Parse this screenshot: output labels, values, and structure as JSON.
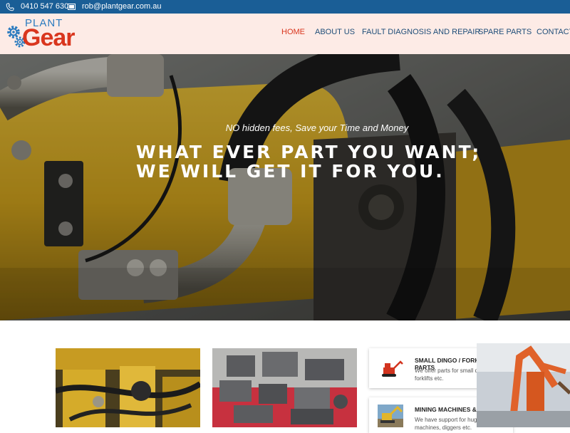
{
  "topbar": {
    "phone": "0410 547 630",
    "email": "rob@plantgear.com.au",
    "background": "#1a5e96"
  },
  "header": {
    "logo_top": "PLANT",
    "logo_main": "Gear",
    "nav": [
      "HOME",
      "ABOUT US",
      "FAULT DIAGNOSIS AND REPAIR",
      "SPARE PARTS",
      "CONTACT"
    ],
    "active_nav": "HOME"
  },
  "hero": {
    "tagline": "NO hidden fees, Save your Time and Money",
    "headline_line1": "WHAT EVER PART YOU WANT;",
    "headline_line2": "WE WILL GET IT FOR YOU."
  },
  "services": [
    {
      "title": "SMALL DINGO / FORKLIFT PARTS",
      "desc": "We offer parts for small dingo, forklifts etc."
    },
    {
      "title": "MINING MACHINES & DIGGERS",
      "desc": "We have support for huge mining machines, diggers etc."
    }
  ],
  "colors": {
    "accent": "#d9361e",
    "nav_text": "#1f4e79",
    "header_bg": "#fdebe6",
    "machine_yellow": "#e2b52a"
  }
}
